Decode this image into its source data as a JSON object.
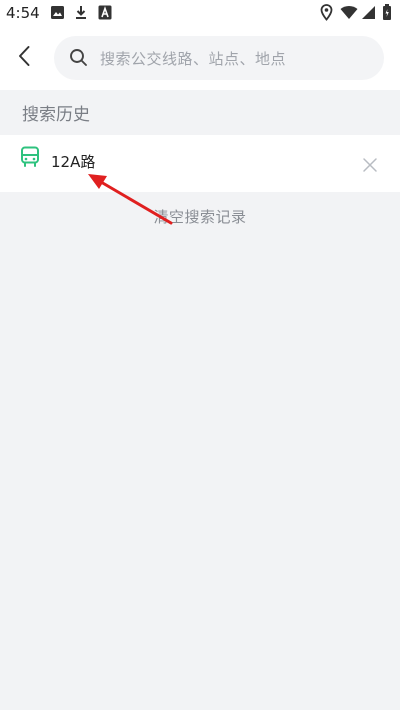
{
  "status_bar": {
    "time": "4:54",
    "left_icons": [
      "image-icon",
      "download-icon",
      "text-a-icon"
    ],
    "right_icons": [
      "location-icon",
      "wifi-icon",
      "signal-icon",
      "battery-icon"
    ]
  },
  "header": {
    "back_icon": "chevron-left-icon",
    "search": {
      "icon": "search-icon",
      "placeholder": "搜索公交线路、站点、地点"
    }
  },
  "history": {
    "title": "搜索历史",
    "items": [
      {
        "icon": "bus-icon",
        "label": "12A路",
        "delete_icon": "close-icon"
      }
    ],
    "clear_label": "清空搜索记录"
  },
  "annotation": {
    "type": "arrow",
    "color": "#e02020"
  },
  "colors": {
    "background": "#f2f3f5",
    "surface": "#ffffff",
    "accent_green": "#2ec27e",
    "muted_text": "#8a8e95"
  }
}
